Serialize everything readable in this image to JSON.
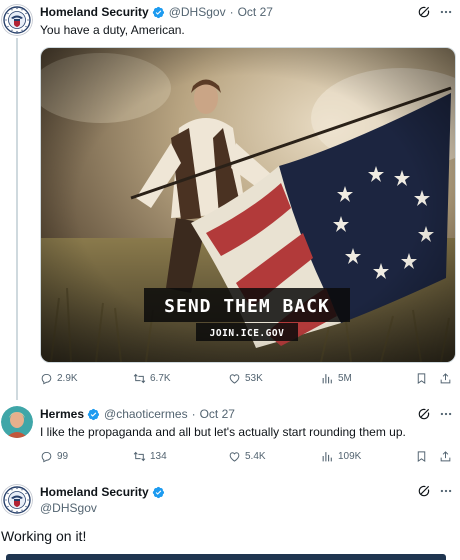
{
  "tweets": [
    {
      "display_name": "Homeland Security",
      "handle": "@DHSgov",
      "separator": "·",
      "date": "Oct 27",
      "text": "You have a duty, American.",
      "media": {
        "headline": "SEND THEM BACK",
        "subline": "JOIN.ICE.GOV"
      },
      "stats": {
        "replies": "2.9K",
        "retweets": "6.7K",
        "likes": "53K",
        "views": "5M"
      }
    },
    {
      "display_name": "Hermes",
      "handle": "@chaoticermes",
      "separator": "·",
      "date": "Oct 27",
      "text": "I like the propaganda and all but let's actually start rounding them up.",
      "stats": {
        "replies": "99",
        "retweets": "134",
        "likes": "5.4K",
        "views": "109K"
      }
    },
    {
      "display_name": "Homeland Security",
      "handle": "@DHSgov",
      "text": "Working on it!"
    }
  ],
  "colors": {
    "verified_blue": "#1d9bf0",
    "text": "#0f1419",
    "muted": "#536471",
    "divider": "#cfd9de"
  },
  "icons": [
    "reply-icon",
    "retweet-icon",
    "like-icon",
    "views-icon",
    "bookmark-icon",
    "share-icon",
    "grok-icon",
    "more-icon",
    "verified-badge-icon"
  ]
}
